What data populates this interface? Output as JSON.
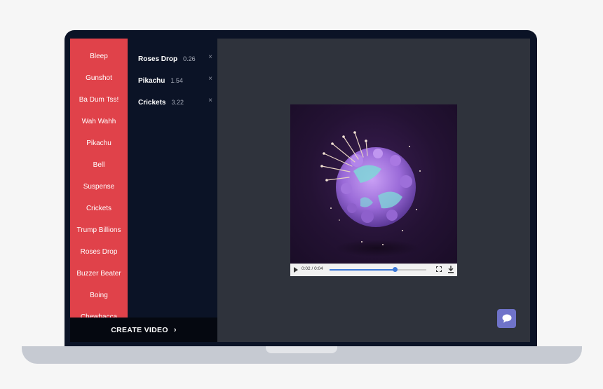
{
  "sounds": [
    {
      "label": "Bleep"
    },
    {
      "label": "Gunshot"
    },
    {
      "label": "Ba Dum Tss!"
    },
    {
      "label": "Wah Wahh"
    },
    {
      "label": "Pikachu"
    },
    {
      "label": "Bell"
    },
    {
      "label": "Suspense"
    },
    {
      "label": "Crickets"
    },
    {
      "label": "Trump Billions"
    },
    {
      "label": "Roses Drop"
    },
    {
      "label": "Buzzer Beater"
    },
    {
      "label": "Boing"
    },
    {
      "label": "Chewbacca"
    }
  ],
  "selected": [
    {
      "name": "Roses Drop",
      "time": "0.26",
      "remove": "×"
    },
    {
      "name": "Pikachu",
      "time": "1.54",
      "remove": "×"
    },
    {
      "name": "Crickets",
      "time": "3.22",
      "remove": "×"
    }
  ],
  "create_button": {
    "label": "CREATE VIDEO",
    "chevron": "›"
  },
  "player": {
    "time": "0:02 / 0:04",
    "progress": 0.68
  },
  "icons": {
    "play": "play-icon",
    "fullscreen": "fullscreen-icon",
    "download": "download-icon",
    "chat": "chat-icon",
    "remove": "close-icon"
  },
  "colors": {
    "sound_list_bg": "#e0424a",
    "panel_bg": "#0b1326",
    "workspace_bg": "#2f333c",
    "chat_accent": "#6f73c9",
    "progress": "#3b78d8"
  }
}
